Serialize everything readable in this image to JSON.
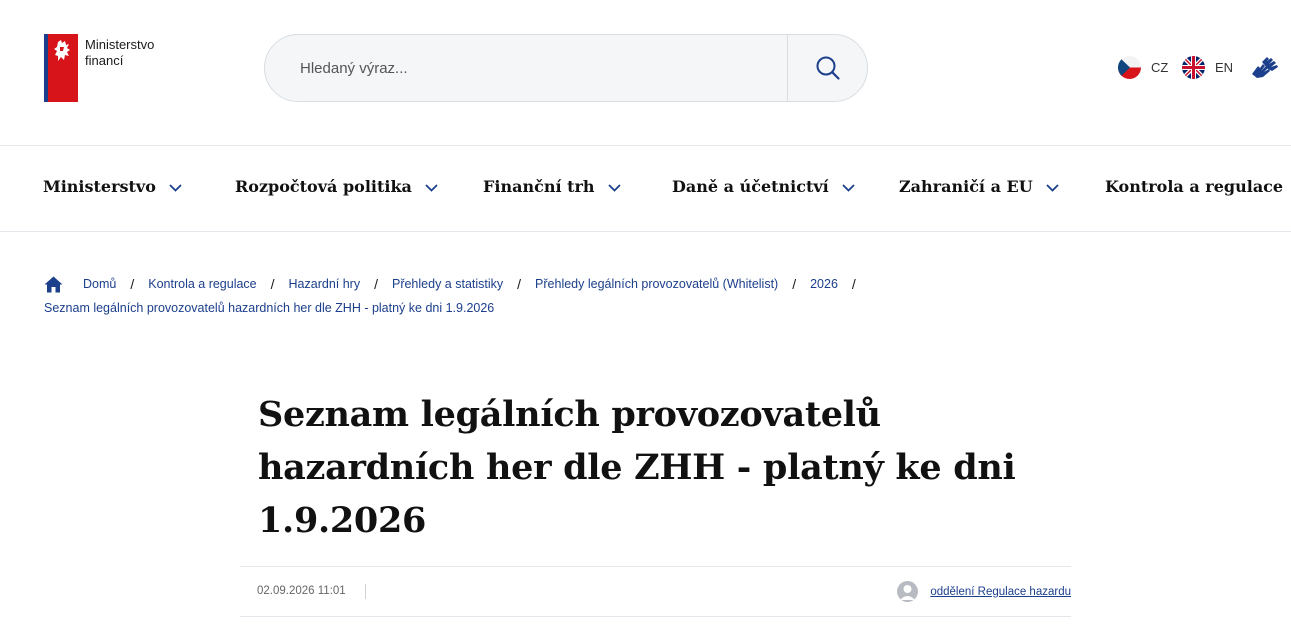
{
  "header": {
    "logo_line1": "Ministerstvo",
    "logo_line2": "financí",
    "search_placeholder": "Hledaný výraz...",
    "languages": [
      {
        "code": "CZ"
      },
      {
        "code": "EN"
      }
    ]
  },
  "nav": {
    "items": [
      {
        "label": "Ministerstvo"
      },
      {
        "label": "Rozpočtová politika"
      },
      {
        "label": "Finanční trh"
      },
      {
        "label": "Daně a účetnictví"
      },
      {
        "label": "Zahraničí a EU"
      },
      {
        "label": "Kontrola a regulace"
      }
    ]
  },
  "breadcrumb": {
    "items": [
      {
        "label": "Domů"
      },
      {
        "label": "Kontrola a regulace"
      },
      {
        "label": "Hazardní hry"
      },
      {
        "label": "Přehledy a statistiky"
      },
      {
        "label": "Přehledy legálních provozovatelů (Whitelist)"
      },
      {
        "label": "2026"
      }
    ],
    "current": "Seznam legálních provozovatelů hazardních her dle ZHH - platný ke dni 1.9.2026"
  },
  "article": {
    "title_line1": "Seznam legálních provozovatelů",
    "title_line2": "hazardních her dle ZHH - platný ke dni",
    "title_line3": "1.9.2026",
    "date": "02.09.2026 11:01",
    "author": "oddělení Regulace hazardu"
  },
  "colors": {
    "brand_blue": "#1c3f8c",
    "brand_red": "#d7141a"
  }
}
